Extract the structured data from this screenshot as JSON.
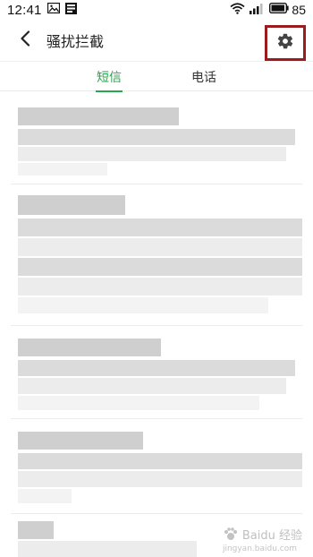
{
  "status_bar": {
    "time": "12:41",
    "battery_level": "85"
  },
  "header": {
    "title": "骚扰拦截"
  },
  "tabs": [
    {
      "label": "短信",
      "active": true
    },
    {
      "label": "电话",
      "active": false
    }
  ],
  "colors": {
    "accent": "#2aa64d",
    "highlight_box": "#9b1c1c"
  },
  "icons": {
    "back": "chevron-left-icon",
    "settings": "gear-icon"
  },
  "watermark": {
    "text": "Baidu 经验",
    "domain": "jingyan.baidu.com"
  }
}
